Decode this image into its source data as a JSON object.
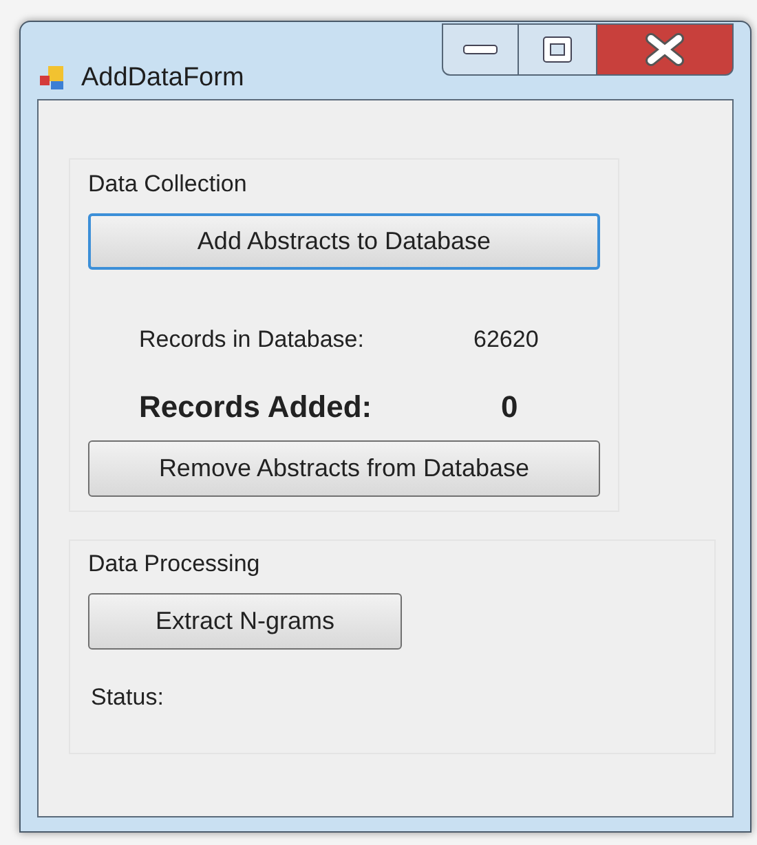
{
  "window": {
    "title": "AddDataForm"
  },
  "groups": [
    {
      "title": "Data Collection",
      "items": [
        {
          "kind": "button",
          "label": "Add Abstracts to Database",
          "focused": true
        },
        {
          "kind": "reading",
          "label": "Records in Database:",
          "value": "62620",
          "emphasis": false
        },
        {
          "kind": "reading",
          "label": "Records Added:",
          "value": "0",
          "emphasis": true
        },
        {
          "kind": "button",
          "label": "Remove Abstracts from Database",
          "focused": false
        }
      ]
    },
    {
      "title": "Data Processing",
      "items": [
        {
          "kind": "button",
          "label": "Extract N-grams",
          "focused": false
        },
        {
          "kind": "label",
          "label": "Status:"
        }
      ]
    }
  ]
}
